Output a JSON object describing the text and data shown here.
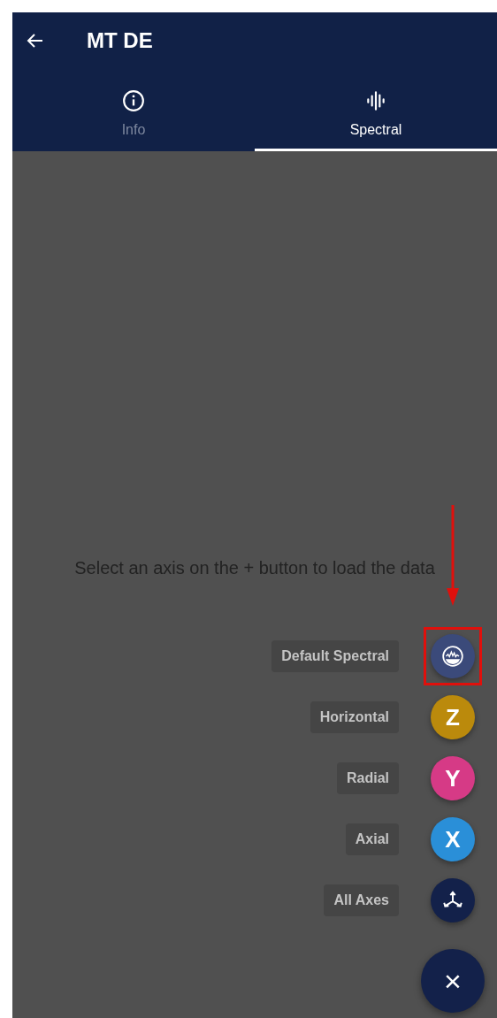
{
  "app_bar": {
    "title": "MT DE"
  },
  "tabs": [
    {
      "label": "Info",
      "kind": "info",
      "selected": false
    },
    {
      "label": "Spectral",
      "kind": "spectral",
      "selected": true
    }
  ],
  "message": "Select an axis on the + button to load the data",
  "fab_menu": {
    "items": [
      {
        "label": "Default Spectral",
        "kind": "spectral",
        "color": "#3b4a7a",
        "highlighted": true
      },
      {
        "label": "Horizontal",
        "kind": "letter",
        "letter": "Z",
        "color": "#bb8a0c",
        "highlighted": false
      },
      {
        "label": "Radial",
        "kind": "letter",
        "letter": "Y",
        "color": "#d63a86",
        "highlighted": false
      },
      {
        "label": "Axial",
        "kind": "letter",
        "letter": "X",
        "color": "#2a8fd8",
        "highlighted": false
      },
      {
        "label": "All Axes",
        "kind": "axes",
        "color": "#13214a",
        "highlighted": false
      }
    ],
    "close_symbol": "×"
  }
}
